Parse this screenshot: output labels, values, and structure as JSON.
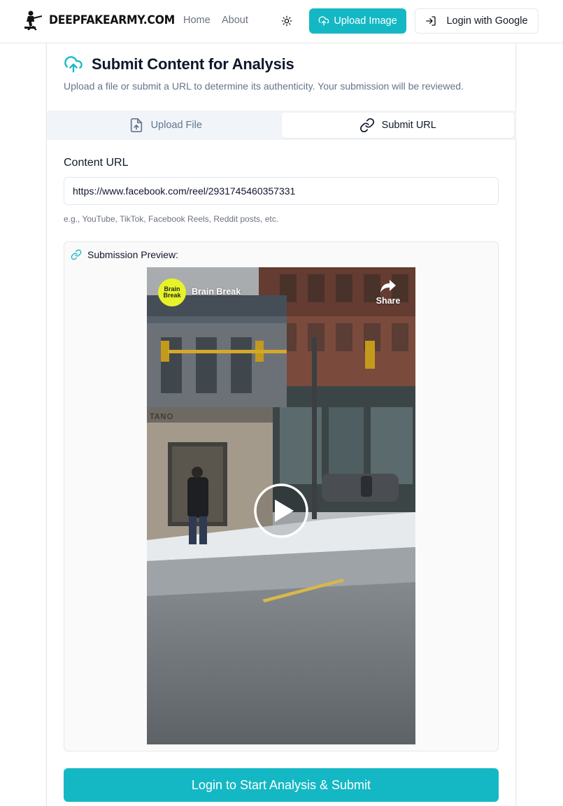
{
  "header": {
    "logo_text": "DEEPFAKEARMY.COM",
    "nav": [
      {
        "label": "Home"
      },
      {
        "label": "About"
      }
    ],
    "upload_button": "Upload Image",
    "login_button": "Login with Google"
  },
  "card": {
    "title": "Submit Content for Analysis",
    "subtitle": "Upload a file or submit a URL to determine its authenticity. Your submission will be reviewed.",
    "tabs": [
      {
        "label": "Upload File",
        "active": false
      },
      {
        "label": "Submit URL",
        "active": true
      }
    ],
    "url_field": {
      "label": "Content URL",
      "value": "https://www.facebook.com/reel/2931745460357331",
      "help": "e.g., YouTube, TikTok, Facebook Reels, Reddit posts, etc."
    },
    "preview": {
      "heading": "Submission Preview:",
      "video": {
        "channel_name": "Brain Break",
        "channel_logo_text": "Brain Break",
        "share_label": "Share",
        "storefront_text": "TANO"
      }
    },
    "submit_button": "Login to Start Analysis & Submit"
  },
  "colors": {
    "accent": "#14b8c4",
    "text": "#0f172a",
    "muted": "#64748b"
  },
  "icons": [
    "logo-soldier-icon",
    "sun-icon",
    "cloud-upload-icon",
    "login-arrow-icon",
    "file-upload-icon",
    "link-icon",
    "share-arrow-icon",
    "play-icon"
  ]
}
